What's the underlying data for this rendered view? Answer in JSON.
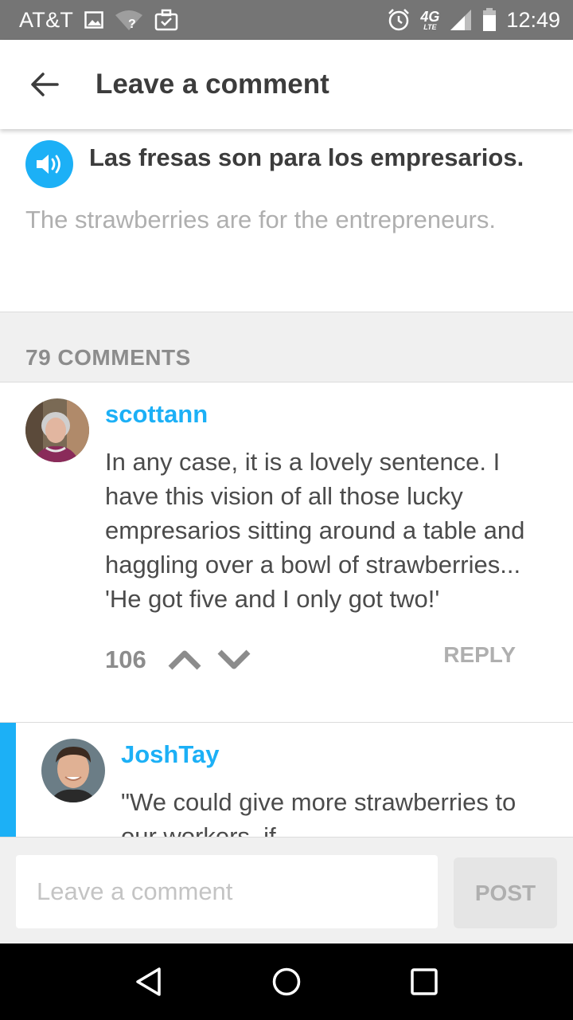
{
  "status_bar": {
    "carrier": "AT&T",
    "network": "4G",
    "network_sub": "LTE",
    "time": "12:49",
    "icons": [
      "image-icon",
      "wifi-icon",
      "briefcase-icon",
      "alarm-icon",
      "signal-icon",
      "battery-icon"
    ]
  },
  "app_bar": {
    "back_icon": "arrow-left-icon",
    "title": "Leave a comment"
  },
  "sentence": {
    "speaker_icon": "speaker-icon",
    "text": "Las fresas son para los empresarios.",
    "translation": "The strawberries are for the entrepreneurs."
  },
  "comments_header": {
    "count_label": "79 COMMENTS"
  },
  "comments": [
    {
      "username": "scottann",
      "text": "In any case, it is a lovely sentence. I have this vision of all those lucky empresarios sitting around a table and haggling over a bowl of strawberries... 'He got five and I only got two!'",
      "votes": "106",
      "reply_label": "REPLY"
    },
    {
      "username": "JoshTay",
      "text": "\"We could give more strawberries to our workers, if"
    }
  ],
  "footer": {
    "input_placeholder": "Leave a comment",
    "post_label": "POST"
  },
  "nav_bar": {
    "icons": [
      "back-triangle-icon",
      "home-circle-icon",
      "recents-square-icon"
    ]
  },
  "colors": {
    "accent": "#1cb0f6",
    "status_bar": "#757575",
    "muted_text": "#afafaf",
    "title_text": "#3c3c3c"
  }
}
